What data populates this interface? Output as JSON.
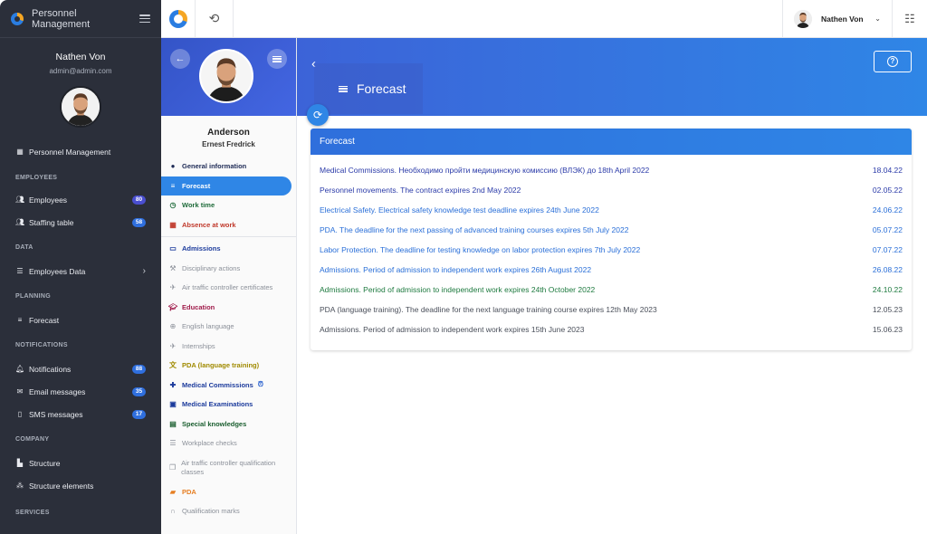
{
  "sidebar": {
    "app_title_line1": "Personnel",
    "app_title_line2": "Management",
    "user_name": "Nathen Von",
    "user_email": "admin@admin.com",
    "top_item": {
      "label": "Personnel Management",
      "icon": "grid-icon"
    },
    "sections": {
      "employees": "EMPLOYEES",
      "data": "DATA",
      "planning": "PLANNING",
      "notifications": "NOTIFICATIONS",
      "company": "COMPANY",
      "services": "SERVICES"
    },
    "items": {
      "employees": {
        "label": "Employees",
        "badge": "80",
        "icon": "people-icon"
      },
      "staffing_table": {
        "label": "Staffing table",
        "badge": "58",
        "icon": "people-icon"
      },
      "employees_data": {
        "label": "Employees Data",
        "icon": "list-icon"
      },
      "forecast": {
        "label": "Forecast",
        "icon": "menu-icon"
      },
      "notifications": {
        "label": "Notifications",
        "badge": "88",
        "icon": "bell-icon"
      },
      "email_messages": {
        "label": "Email messages",
        "badge": "35",
        "icon": "mail-icon"
      },
      "sms_messages": {
        "label": "SMS messages",
        "badge": "17",
        "icon": "phone-icon"
      },
      "structure": {
        "label": "Structure",
        "icon": "building-icon"
      },
      "structure_elements": {
        "label": "Structure elements",
        "icon": "nodes-icon"
      }
    }
  },
  "topbar": {
    "user_name": "Nathen Von"
  },
  "person": {
    "surname": "Anderson",
    "given_names": "Ernest Fredrick"
  },
  "person_menu": [
    {
      "label": "General information",
      "icon": "account-circle-icon",
      "color": "#1d2a55",
      "bold": true
    },
    {
      "label": "Forecast",
      "icon": "menu-icon",
      "color": "#ffffff",
      "bold": true,
      "active": true
    },
    {
      "label": "Work time",
      "icon": "clock-icon",
      "color": "#1f6b3a",
      "bold": true
    },
    {
      "label": "Absence at work",
      "icon": "calendar-icon",
      "color": "#c0392b",
      "bold": true
    },
    {
      "label": "Admissions",
      "icon": "monitor-icon",
      "color": "#1c3b9c",
      "bold": true
    },
    {
      "label": "Disciplinary actions",
      "icon": "gavel-icon",
      "color": "#8a8f98",
      "bold": false
    },
    {
      "label": "Air traffic controller certificates",
      "icon": "plane-icon",
      "color": "#8a8f98",
      "bold": false
    },
    {
      "label": "Education",
      "icon": "graduation-cap-icon",
      "color": "#a01c4b",
      "bold": true
    },
    {
      "label": "English language",
      "icon": "globe-icon",
      "color": "#8a8f98",
      "bold": false
    },
    {
      "label": "Internships",
      "icon": "plane-icon",
      "color": "#8a8f98",
      "bold": false
    },
    {
      "label": "PDA (language training)",
      "icon": "translate-icon",
      "color": "#a08a00",
      "bold": true
    },
    {
      "label": "Medical Commissions",
      "icon": "medical-plus-icon",
      "color": "#1c3b9c",
      "bold": true,
      "alert": true
    },
    {
      "label": "Medical Examinations",
      "icon": "medical-bag-icon",
      "color": "#1c3b9c",
      "bold": true
    },
    {
      "label": "Special knowledges",
      "icon": "id-card-icon",
      "color": "#1a5e2f",
      "bold": true
    },
    {
      "label": "Workplace checks",
      "icon": "checklist-icon",
      "color": "#8a8f98",
      "bold": false
    },
    {
      "label": "Air traffic controller qualification classes",
      "icon": "copy-icon",
      "color": "#8a8f98",
      "bold": false
    },
    {
      "label": "PDA",
      "icon": "folder-icon",
      "color": "#e67e22",
      "bold": true
    },
    {
      "label": "Qualification marks",
      "icon": "headset-icon",
      "color": "#8a8f98",
      "bold": false
    }
  ],
  "page": {
    "title": "Forecast",
    "card_title": "Forecast"
  },
  "forecast_rows": [
    {
      "text": "Medical Commissions. Необходимо пройти медицинскую комиссию (ВЛЭК) до 18th April 2022",
      "date": "18.04.22",
      "color": "#2a3aa8"
    },
    {
      "text": "Personnel movements. The contract expires 2nd May 2022",
      "date": "02.05.22",
      "color": "#2a3aa8"
    },
    {
      "text": "Electrical Safety. Electrical safety knowledge test deadline expires 24th June 2022",
      "date": "24.06.22",
      "color": "#2a6fd8"
    },
    {
      "text": "PDA. The deadline for the next passing of advanced training courses expires 5th July 2022",
      "date": "05.07.22",
      "color": "#2a6fd8"
    },
    {
      "text": "Labor Protection. The deadline for testing knowledge on labor protection expires 7th July 2022",
      "date": "07.07.22",
      "color": "#2a6fd8"
    },
    {
      "text": "Admissions. Period of admission to independent work expires 26th August 2022",
      "date": "26.08.22",
      "color": "#2a6fd8"
    },
    {
      "text": "Admissions. Period of admission to independent work expires 24th October 2022",
      "date": "24.10.22",
      "color": "#1e7a3f"
    },
    {
      "text": "PDA (language training). The deadline for the next language training course expires 12th May 2023",
      "date": "12.05.23",
      "color": "#4a4f5a"
    },
    {
      "text": "Admissions. Period of admission to independent work expires 15th June 2023",
      "date": "15.06.23",
      "color": "#4a4f5a"
    }
  ]
}
